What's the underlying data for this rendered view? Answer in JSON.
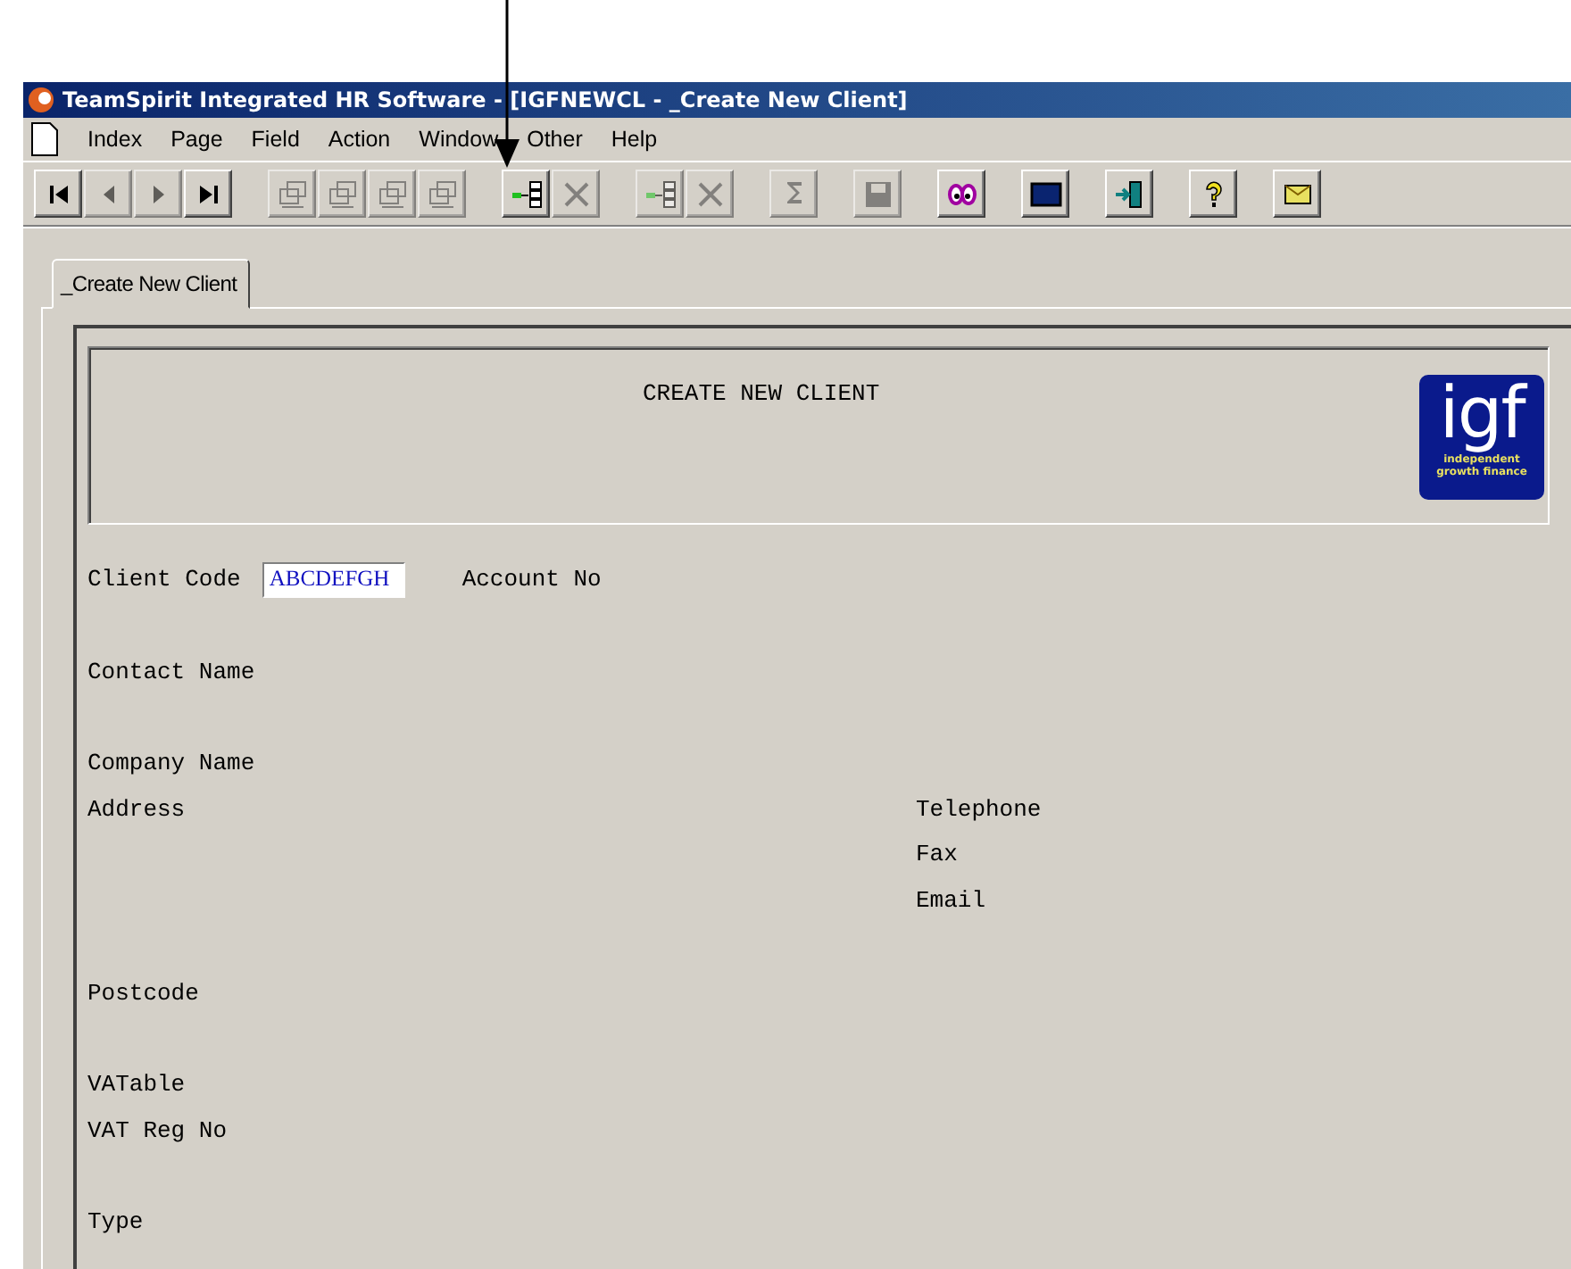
{
  "window": {
    "title": "TeamSpirit Integrated HR Software - [IGFNEWCL - _Create New Client]"
  },
  "menu": [
    "Index",
    "Page",
    "Field",
    "Action",
    "Window",
    "Other",
    "Help"
  ],
  "toolbar": [
    [
      {
        "kind": "first",
        "disabled": false
      },
      {
        "kind": "prev",
        "disabled": true
      },
      {
        "kind": "next",
        "disabled": true
      },
      {
        "kind": "last",
        "disabled": false
      }
    ],
    [
      {
        "kind": "record-first",
        "disabled": true
      },
      {
        "kind": "record-prev",
        "disabled": true
      },
      {
        "kind": "record-next",
        "disabled": true
      },
      {
        "kind": "record-last",
        "disabled": true
      }
    ],
    [
      {
        "kind": "insert",
        "disabled": false
      },
      {
        "kind": "delete",
        "disabled": true
      }
    ],
    [
      {
        "kind": "insert",
        "disabled": true
      },
      {
        "kind": "delete",
        "disabled": true
      }
    ],
    [
      {
        "kind": "calc",
        "disabled": true
      }
    ],
    [
      {
        "kind": "save",
        "disabled": true
      }
    ],
    [
      {
        "kind": "view",
        "disabled": false
      }
    ],
    [
      {
        "kind": "screen",
        "disabled": false
      }
    ],
    [
      {
        "kind": "exit",
        "disabled": false
      }
    ],
    [
      {
        "kind": "help",
        "disabled": false
      }
    ],
    [
      {
        "kind": "mail",
        "disabled": false
      }
    ]
  ],
  "tabs": [
    {
      "label": "_Create New Client",
      "selected": true
    }
  ],
  "header": {
    "title": "CREATE NEW CLIENT",
    "logo": {
      "mark": "igf",
      "line_1": "independent",
      "line_2": "growth finance"
    }
  },
  "form_groups": [
    [
      {
        "label": "Client Code",
        "value": "ABCDEFGH",
        "extra_label": "Account No"
      }
    ],
    [
      {
        "label": "Contact Name"
      }
    ],
    [
      {
        "label": "Company Name"
      },
      {
        "label": "Address",
        "right_label": "Telephone"
      },
      {
        "right_label": "Fax"
      },
      {
        "right_label": "Email"
      }
    ],
    [
      {
        "label": "Postcode"
      }
    ],
    [
      {
        "label": "VATable"
      },
      {
        "label": "VAT Reg No"
      }
    ],
    [
      {
        "label": "Type"
      }
    ]
  ]
}
